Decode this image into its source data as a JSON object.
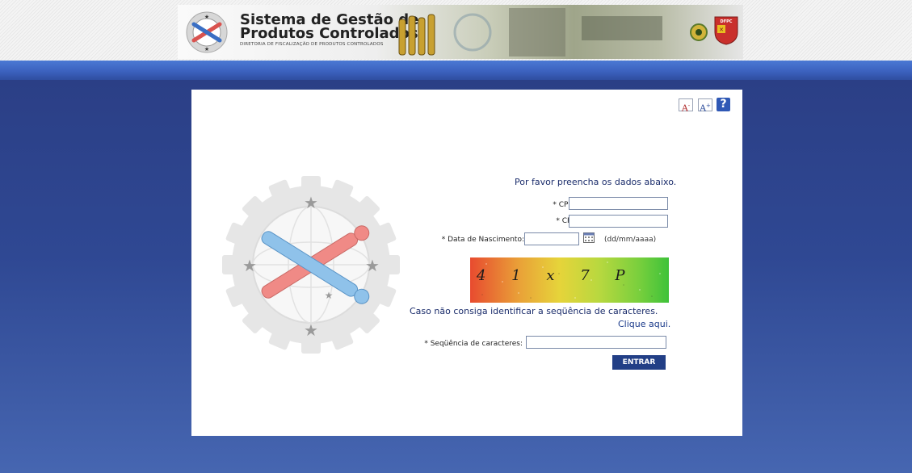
{
  "header": {
    "title_line1": "Sistema de Gestão de",
    "title_line2": "Produtos Controlados",
    "subtitle": "DIRETORIA DE FISCALIZAÇÃO DE PRODUTOS CONTROLADOS",
    "badge_text": "DFPC"
  },
  "toolbar": {
    "font_decrease_label": "A",
    "font_decrease_sign": "-",
    "font_increase_label": "A",
    "font_increase_sign": "+",
    "help_label": "?"
  },
  "form": {
    "intro": "Por favor preencha os dados abaixo.",
    "cpf_label": "* CPF:",
    "cpf_value": "",
    "cr_label": "* CR:",
    "cr_value": "",
    "birthdate_label": "* Data de Nascimento:",
    "birthdate_value": "",
    "birthdate_hint": "(dd/mm/aaaa)",
    "captcha_text": "4 1 x 7 P",
    "captcha_hint": "Caso não consiga identificar a seqüência de caracteres.",
    "captcha_link": "Clique aqui.",
    "sequence_label": "* Seqüência de caracteres:",
    "sequence_value": "",
    "submit_label": "ENTRAR"
  },
  "icons": {
    "logo": "crossed-cannons-gear-logo",
    "calendar": "calendar-icon",
    "help": "help-icon"
  },
  "colors": {
    "page_background": "#2f4893",
    "strip": "#3c62bf",
    "submit_button": "#223f86",
    "link": "#1a3a8a"
  }
}
